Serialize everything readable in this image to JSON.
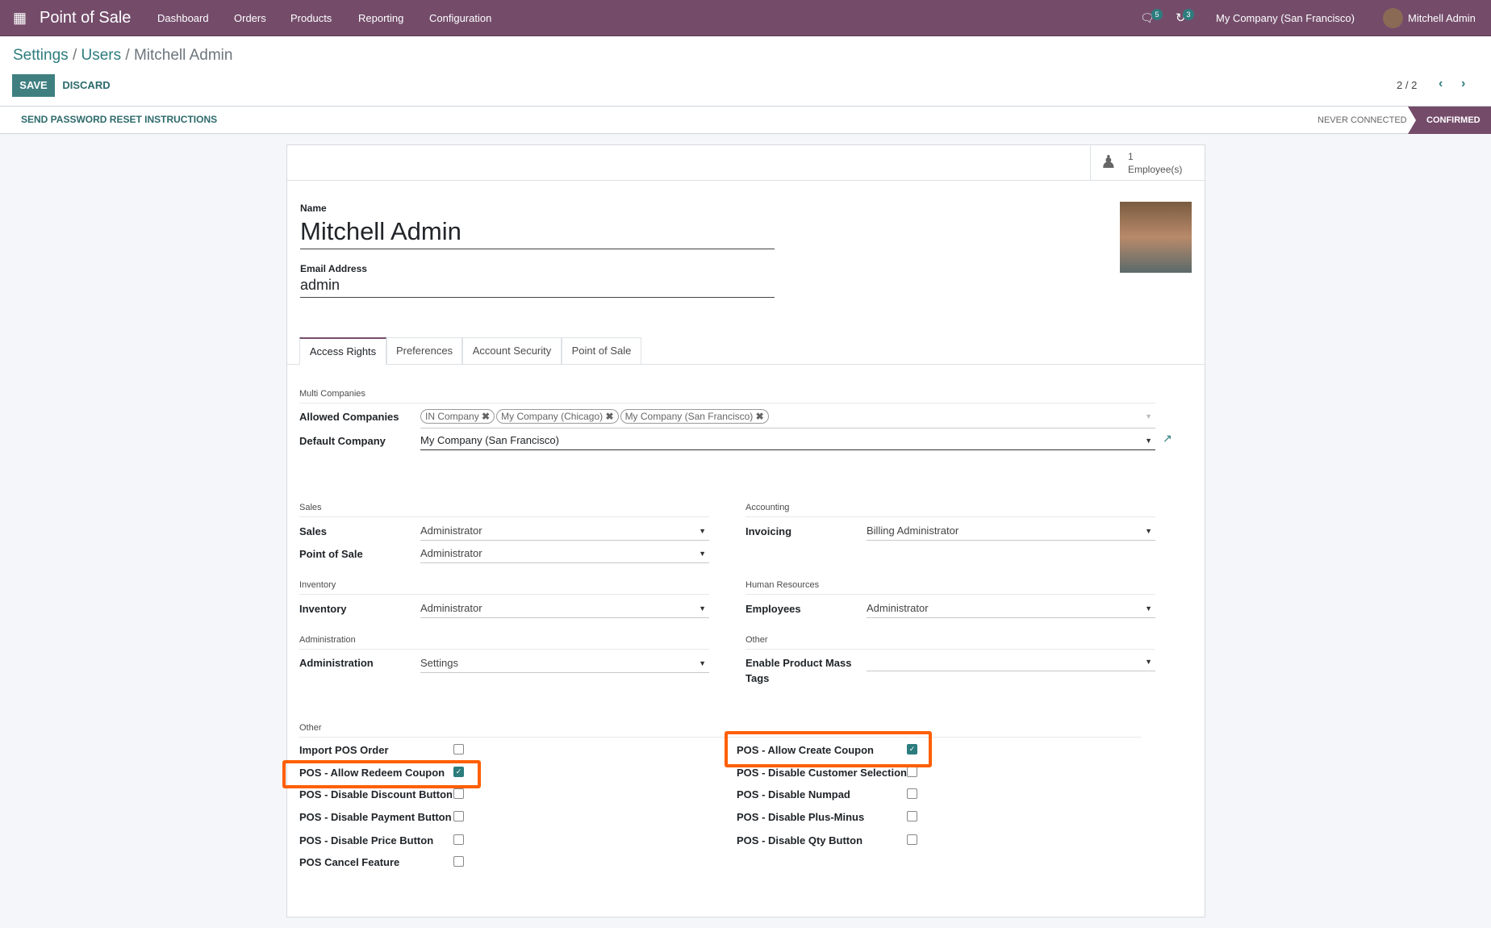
{
  "nav": {
    "app": "Point of Sale",
    "menus": [
      "Dashboard",
      "Orders",
      "Products",
      "Reporting",
      "Configuration"
    ],
    "messages_count": "5",
    "activities_count": "3",
    "company": "My Company (San Francisco)",
    "user": "Mitchell Admin"
  },
  "breadcrumb": {
    "settings": "Settings",
    "users": "Users",
    "current": "Mitchell Admin",
    "sep": "/"
  },
  "buttons": {
    "save": "SAVE",
    "discard": "DISCARD",
    "reset": "SEND PASSWORD RESET INSTRUCTIONS"
  },
  "pager": "2 / 2",
  "status": {
    "never": "NEVER CONNECTED",
    "confirmed": "CONFIRMED"
  },
  "employees": {
    "count": "1",
    "label": "Employee(s)"
  },
  "form": {
    "name_label": "Name",
    "name": "Mitchell Admin",
    "email_label": "Email Address",
    "email": "admin"
  },
  "tabs": [
    "Access Rights",
    "Preferences",
    "Account Security",
    "Point of Sale"
  ],
  "multi": {
    "header": "Multi Companies",
    "allowed_label": "Allowed Companies",
    "allowed": [
      "IN Company",
      "My Company (Chicago)",
      "My Company (San Francisco)"
    ],
    "default_label": "Default Company",
    "default": "My Company (San Francisco)"
  },
  "groups": {
    "sales_h": "Sales",
    "sales_l": "Sales",
    "sales_v": "Administrator",
    "pos_l": "Point of Sale",
    "pos_v": "Administrator",
    "acc_h": "Accounting",
    "inv_l": "Invoicing",
    "inv_v": "Billing Administrator",
    "inventory_h": "Inventory",
    "inventory_l": "Inventory",
    "inventory_v": "Administrator",
    "hr_h": "Human Resources",
    "emp_l": "Employees",
    "emp_v": "Administrator",
    "admin_h": "Administration",
    "admin_l": "Administration",
    "admin_v": "Settings",
    "other_h": "Other",
    "mass_l": "Enable Product Mass",
    "mass_l2": "Tags",
    "mass_v": ""
  },
  "other": {
    "header": "Other",
    "left": [
      {
        "label": "Import POS Order",
        "checked": false
      },
      {
        "label": "POS - Allow Redeem Coupon",
        "checked": true
      },
      {
        "label": "POS - Disable Discount Button",
        "checked": false
      },
      {
        "label": "POS - Disable Payment Button",
        "checked": false
      },
      {
        "label": "POS - Disable Price Button",
        "checked": false
      },
      {
        "label": "POS Cancel Feature",
        "checked": false
      }
    ],
    "right": [
      {
        "label": "POS - Allow Create Coupon",
        "checked": true
      },
      {
        "label": "POS - Disable Customer Selection",
        "checked": false
      },
      {
        "label": "POS - Disable Numpad",
        "checked": false
      },
      {
        "label": "POS - Disable Plus-Minus",
        "checked": false
      },
      {
        "label": "POS - Disable Qty Button",
        "checked": false
      }
    ]
  },
  "colors": {
    "brand": "#744c6a",
    "accent": "#2d7c7e",
    "highlight": "#ff5f00"
  }
}
